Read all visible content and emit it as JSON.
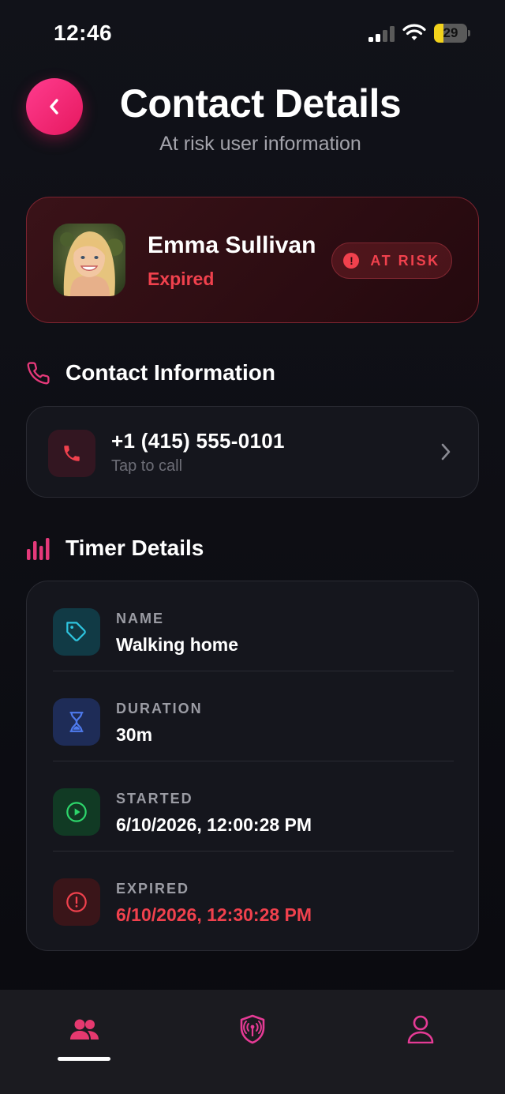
{
  "status_bar": {
    "time": "12:46",
    "battery": "29",
    "battery_level": 0.29
  },
  "header": {
    "title": "Contact Details",
    "subtitle": "At risk user information",
    "back_icon": "chevron-left-icon"
  },
  "user": {
    "name": "Emma Sullivan",
    "status": "Expired",
    "badge": "AT RISK"
  },
  "contact_section": {
    "title": "Contact Information",
    "phone": "+1 (415) 555-0101",
    "hint": "Tap to call"
  },
  "timer_section": {
    "title": "Timer Details",
    "rows": [
      {
        "label": "NAME",
        "value": "Walking home",
        "icon": "tag-icon"
      },
      {
        "label": "DURATION",
        "value": "30m",
        "icon": "hourglass-icon"
      },
      {
        "label": "STARTED",
        "value": "6/10/2026, 12:00:28 PM",
        "icon": "play-circle-icon"
      },
      {
        "label": "EXPIRED",
        "value": "6/10/2026, 12:30:28 PM",
        "icon": "alert-circle-icon"
      }
    ]
  },
  "tab_bar": {
    "tabs": [
      "contacts-icon",
      "shield-signal-icon",
      "profile-icon"
    ],
    "active": 0
  },
  "colors": {
    "accent": "#e6185f",
    "danger": "#f0414d",
    "pink": "#e53b95",
    "background": "#0e0f15"
  }
}
